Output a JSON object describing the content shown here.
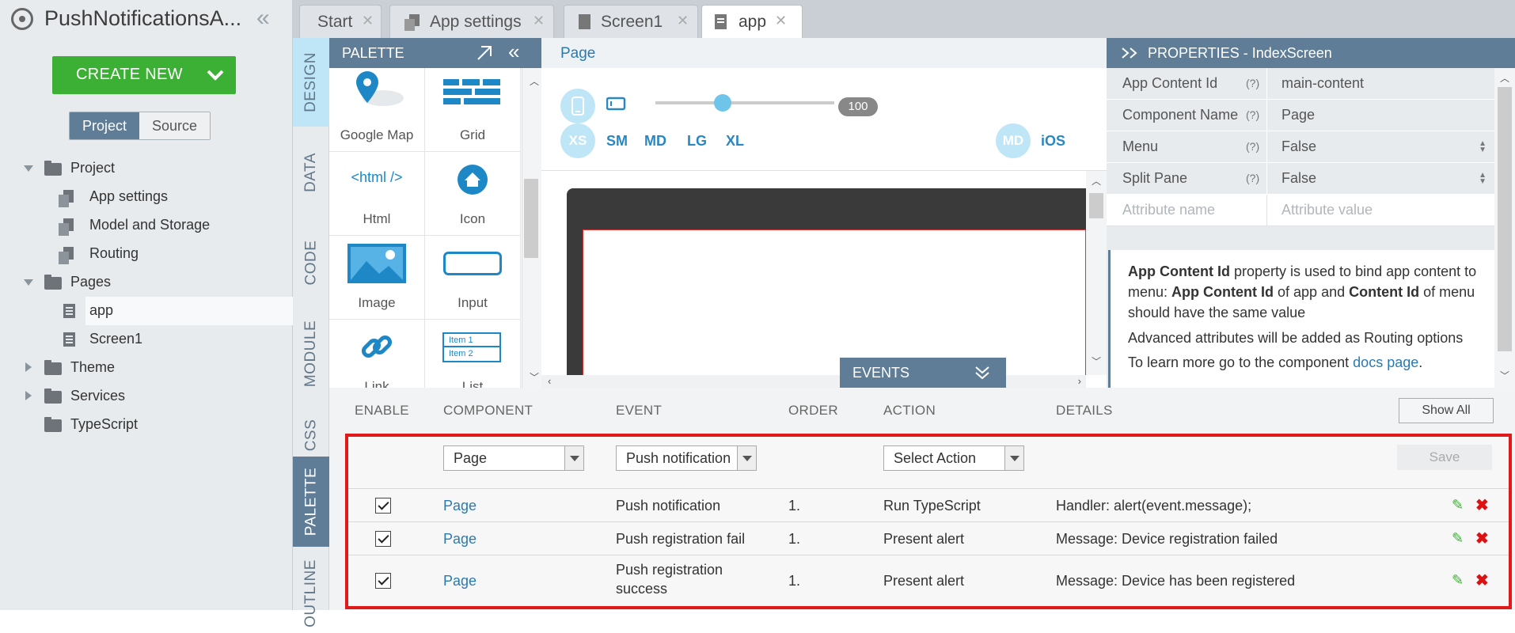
{
  "app": {
    "title": "PushNotificationsA..."
  },
  "left": {
    "create_label": "CREATE NEW",
    "seg": {
      "project": "Project",
      "source": "Source"
    },
    "tree": {
      "project": "Project",
      "app_settings": "App settings",
      "model_storage": "Model and Storage",
      "routing": "Routing",
      "pages": "Pages",
      "app": "app",
      "screen1": "Screen1",
      "theme": "Theme",
      "services": "Services",
      "typescript": "TypeScript"
    }
  },
  "tabs": [
    {
      "label": "Start"
    },
    {
      "label": "App settings"
    },
    {
      "label": "Screen1"
    },
    {
      "label": "app"
    }
  ],
  "sidetabs": {
    "design": "DESIGN",
    "data": "DATA",
    "code": "CODE",
    "module": "MODULE",
    "css": "CSS",
    "palette": "PALETTE",
    "outline": "OUTLINE"
  },
  "palette": {
    "title": "PALETTE",
    "items": [
      {
        "label": "Google Map"
      },
      {
        "label": "Grid"
      },
      {
        "label": "Html",
        "glyph": "<html />"
      },
      {
        "label": "Icon"
      },
      {
        "label": "Image"
      },
      {
        "label": "Input"
      },
      {
        "label": "Link"
      },
      {
        "label": "List",
        "item1": "Item 1",
        "item2": "Item 2"
      }
    ]
  },
  "page": {
    "title": "Page",
    "zoom": "100",
    "breakpoints": [
      "XS",
      "SM",
      "MD",
      "LG",
      "XL"
    ],
    "platforms": {
      "md": "MD",
      "ios": "iOS"
    },
    "events_title": "EVENTS"
  },
  "properties": {
    "title": "PROPERTIES - IndexScreen",
    "rows": [
      {
        "key": "App Content Id",
        "help": "(?)",
        "value": "main-content"
      },
      {
        "key": "Component Name",
        "help": "(?)",
        "value": "Page"
      },
      {
        "key": "Menu",
        "help": "(?)",
        "value": "False"
      },
      {
        "key": "Split Pane",
        "help": "(?)",
        "value": "False"
      }
    ],
    "attr_name_placeholder": "Attribute name",
    "attr_value_placeholder": "Attribute value",
    "info": {
      "b1": "App Content Id",
      "t1": " property is used to bind app content to menu: ",
      "b2": "App Content Id",
      "t2": " of app and ",
      "b3": "Content Id",
      "t3": " of menu should have the same value",
      "p2": "Advanced attributes will be added as Routing options",
      "p3a": "To learn more go to the component ",
      "p3link": "docs page",
      "p3b": "."
    }
  },
  "events": {
    "headers": {
      "enable": "ENABLE",
      "component": "COMPONENT",
      "event": "EVENT",
      "order": "ORDER",
      "action": "ACTION",
      "details": "DETAILS"
    },
    "show_all": "Show All",
    "new": {
      "component": "Page",
      "event": "Push notification",
      "action": "Select Action",
      "save": "Save"
    },
    "rows": [
      {
        "component": "Page",
        "event": "Push notification",
        "order": "1.",
        "action": "Run TypeScript",
        "details": "Handler: alert(event.message);"
      },
      {
        "component": "Page",
        "event": "Push registration fail",
        "order": "1.",
        "action": "Present alert",
        "details": "Message: Device registration failed"
      },
      {
        "component": "Page",
        "event_l1": "Push registration",
        "event_l2": "success",
        "order": "1.",
        "action": "Present alert",
        "details": "Message: Device has been registered"
      }
    ]
  },
  "colors": {
    "accent": "#5f7d96",
    "create": "#3cb034",
    "highlight": "#e01a1a",
    "link": "#2a7ab0"
  }
}
